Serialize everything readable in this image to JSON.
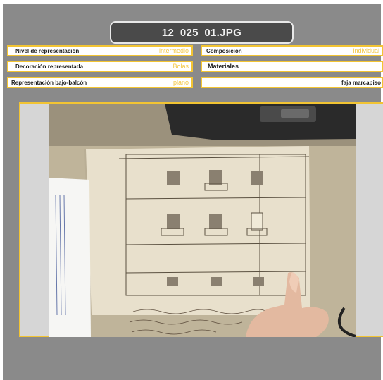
{
  "title": "12_025_01.JPG",
  "fields": {
    "nivel": {
      "label": "Nivel de representación",
      "value": "intermedio"
    },
    "decoracion": {
      "label": "Decoración representada",
      "value": "Bolas"
    },
    "bajo_balcon": {
      "label": "Representación bajo-balcón",
      "value": "plano"
    },
    "composicion": {
      "label": "Composición",
      "value": "individual"
    },
    "materiales": {
      "label": "Materiales",
      "value": ""
    },
    "extra": {
      "label": "",
      "value": "faja marcapiso"
    }
  },
  "colors": {
    "accent": "#f2c433",
    "background": "#8a8a8a",
    "title_bg": "#4a4a4a"
  }
}
